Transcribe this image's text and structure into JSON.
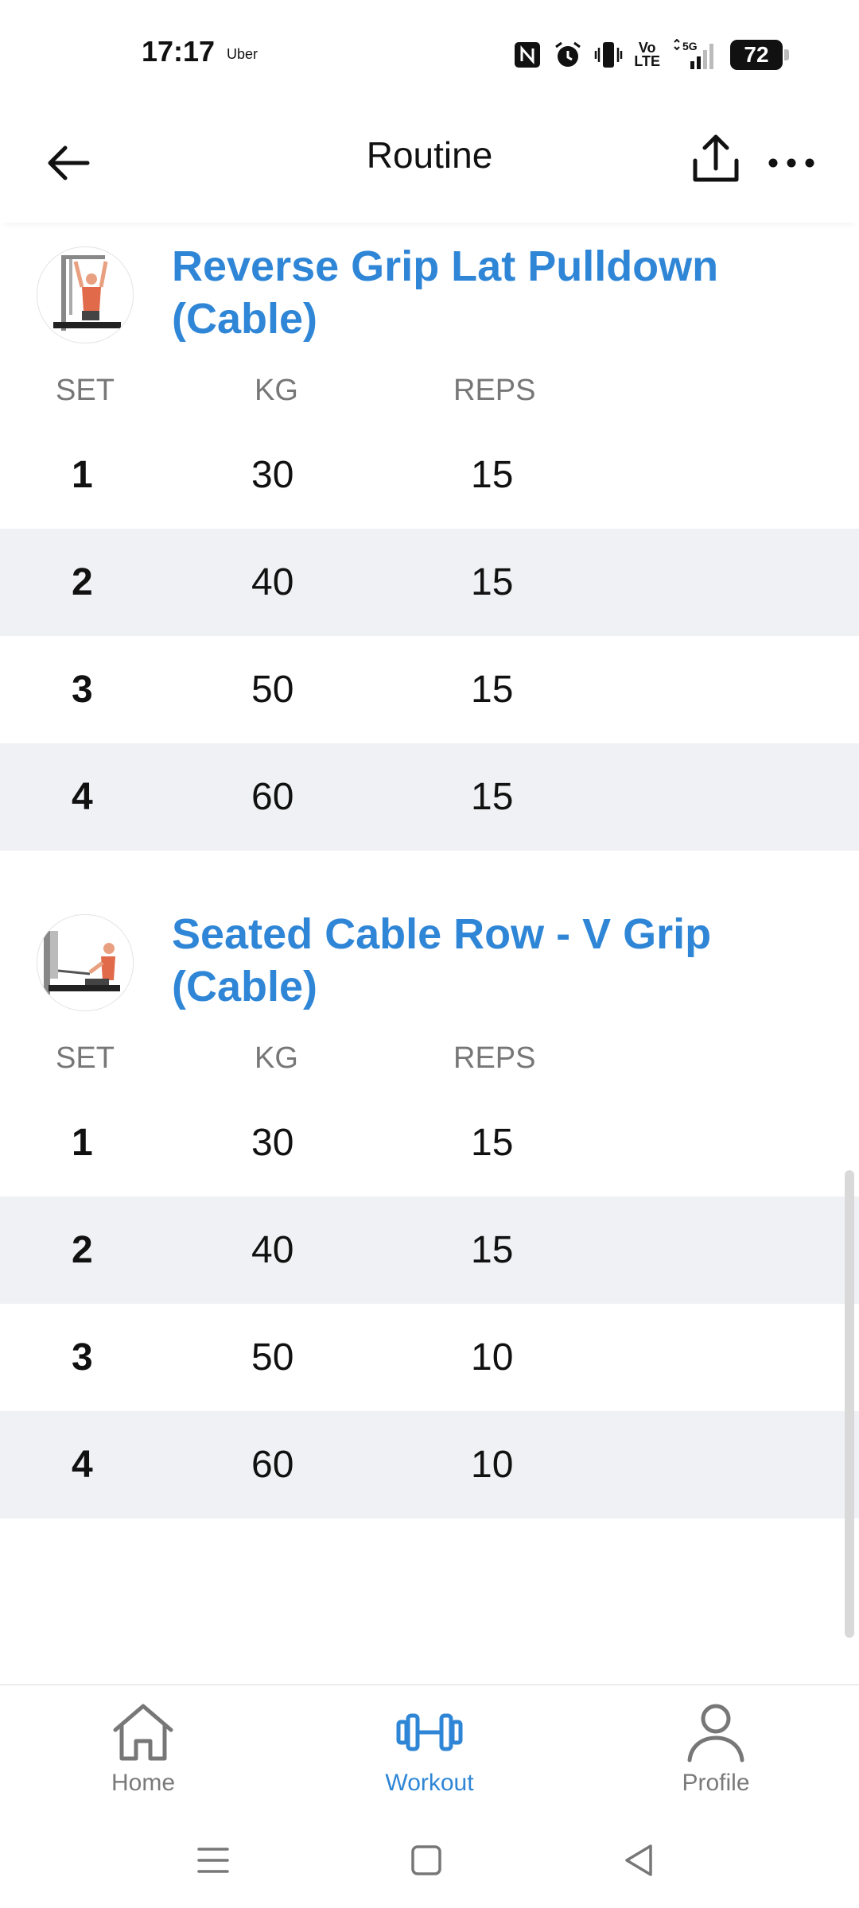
{
  "status_bar": {
    "time": "17:17",
    "carrier": "Uber",
    "network_top": "Vo",
    "network_bottom": "LTE",
    "signal": "5G",
    "battery": "72"
  },
  "header": {
    "title": "Routine"
  },
  "exercises": [
    {
      "name": "Reverse Grip Lat Pulldown (Cable)",
      "columns": {
        "set": "SET",
        "kg": "KG",
        "reps": "REPS"
      },
      "sets": [
        {
          "set": "1",
          "kg": "30",
          "reps": "15"
        },
        {
          "set": "2",
          "kg": "40",
          "reps": "15"
        },
        {
          "set": "3",
          "kg": "50",
          "reps": "15"
        },
        {
          "set": "4",
          "kg": "60",
          "reps": "15"
        }
      ]
    },
    {
      "name": "Seated Cable Row - V Grip (Cable)",
      "columns": {
        "set": "SET",
        "kg": "KG",
        "reps": "REPS"
      },
      "sets": [
        {
          "set": "1",
          "kg": "30",
          "reps": "15"
        },
        {
          "set": "2",
          "kg": "40",
          "reps": "15"
        },
        {
          "set": "3",
          "kg": "50",
          "reps": "10"
        },
        {
          "set": "4",
          "kg": "60",
          "reps": "10"
        }
      ]
    }
  ],
  "bottom_nav": {
    "home": {
      "label": "Home",
      "icon": "home-icon"
    },
    "workout": {
      "label": "Workout",
      "icon": "dumbbell-icon",
      "active": true
    },
    "profile": {
      "label": "Profile",
      "icon": "person-icon"
    }
  },
  "colors": {
    "accent": "#2f86d6",
    "shade_row": "#f0f1f4",
    "muted": "#7a7a7a"
  }
}
